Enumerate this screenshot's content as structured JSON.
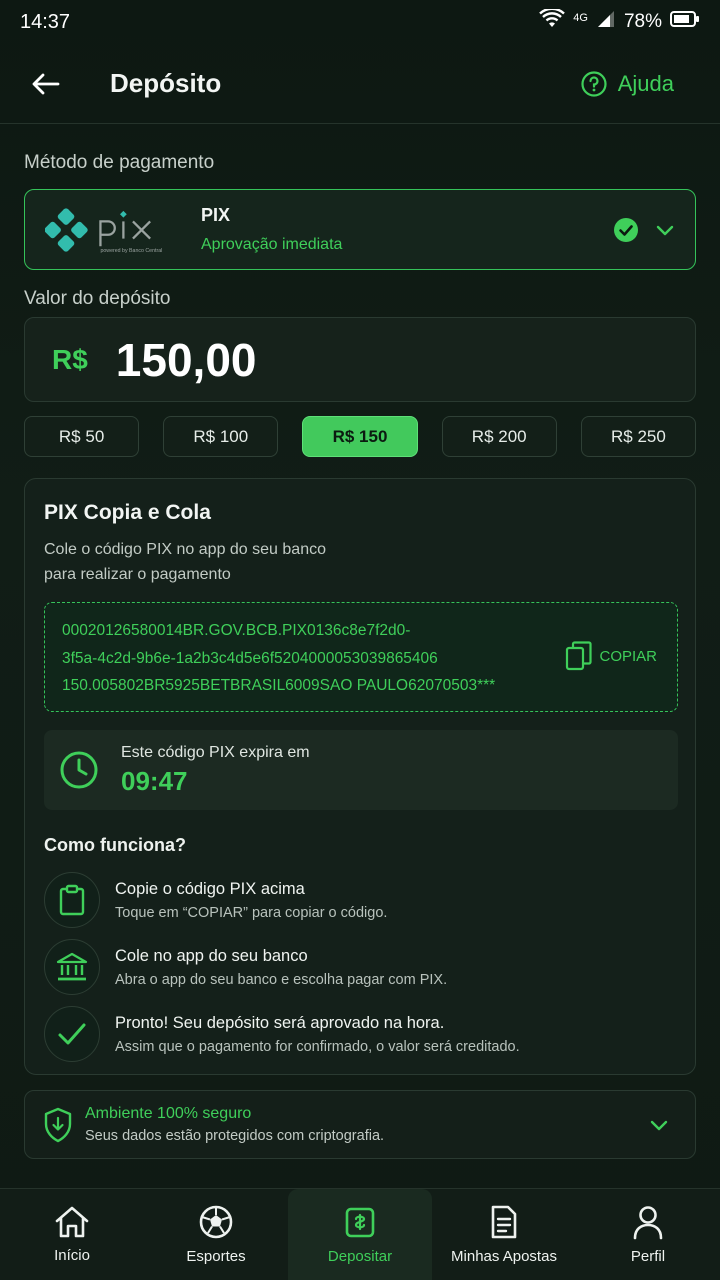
{
  "status_bar": {
    "time": "14:37",
    "network": "4G",
    "battery": "78%"
  },
  "header": {
    "title": "Depósito",
    "help_label": "Ajuda"
  },
  "payment_method": {
    "section_label": "Método de pagamento",
    "name": "PIX",
    "subtitle": "Aprovação imediata",
    "logo_text": "pix",
    "logo_subtext": "powered by Banco Central"
  },
  "deposit": {
    "section_label": "Valor do depósito",
    "currency": "R$",
    "value": "150,00",
    "quick_amounts": [
      "R$ 50",
      "R$ 100",
      "R$ 150",
      "R$ 200",
      "R$ 250"
    ],
    "selected_quick_amount": "R$ 150"
  },
  "pix_card": {
    "title": "PIX Copia e Cola",
    "desc_line1": "Cole o código PIX no app do seu banco",
    "desc_line2": "para realizar o pagamento",
    "code_line1": "00020126580014BR.GOV.BCB.PIX0136c8e7f2d0-",
    "code_line2": "3f5a-4c2d-9b6e-1a2b3c4d5e6f5204000053039865406",
    "code_line3": "150.005802BR5925BETBRASIL6009SAO PAULO62070503***",
    "copy_label": "COPIAR",
    "expire_label": "Este código PIX expira em",
    "expire_time": "09:47",
    "how_title": "Como funciona?",
    "steps": [
      {
        "title": "Copie o código PIX acima",
        "desc": "Toque em “COPIAR” para copiar o código."
      },
      {
        "title": "Cole no app do seu banco",
        "desc": "Abra o app do seu banco e escolha pagar com PIX."
      },
      {
        "title": "Pronto! Seu depósito será aprovado na hora.",
        "desc": "Assim que o pagamento for confirmado, o valor será creditado."
      }
    ]
  },
  "secure": {
    "title": "Ambiente 100% seguro",
    "desc": "Seus dados estão protegidos com criptografia."
  },
  "bottom_nav": [
    {
      "label": "Início",
      "icon": "home-icon"
    },
    {
      "label": "Esportes",
      "icon": "soccer-ball-icon"
    },
    {
      "label": "Depositar",
      "icon": "deposit-icon"
    },
    {
      "label": "Minhas Apostas",
      "icon": "bets-document-icon"
    },
    {
      "label": "Perfil",
      "icon": "profile-icon"
    }
  ],
  "colors": {
    "accent": "#3fcf5a",
    "background": "#0f1a14",
    "card": "#14201a"
  }
}
